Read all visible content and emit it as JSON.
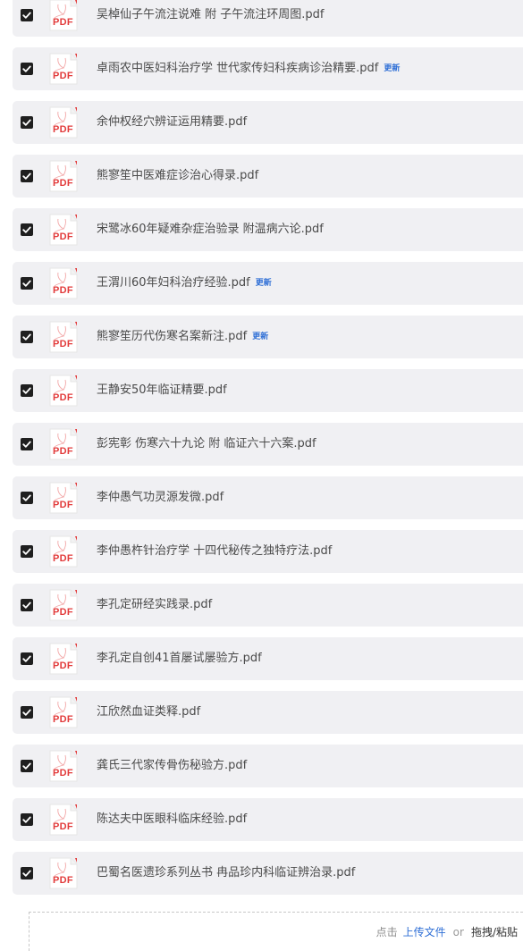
{
  "files": [
    {
      "name": "吴棹仙子午流注说难  附  子午流注环周图.pdf",
      "checked": true,
      "badge": ""
    },
    {
      "name": "卓雨农中医妇科治疗学  世代家传妇科疾病诊治精要.pdf",
      "checked": true,
      "badge": "更新"
    },
    {
      "name": "余仲权经穴辨证运用精要.pdf",
      "checked": true,
      "badge": ""
    },
    {
      "name": "熊寥笙中医难症诊治心得录.pdf",
      "checked": true,
      "badge": ""
    },
    {
      "name": "宋鹭冰60年疑难杂症治验录    附温病六论.pdf",
      "checked": true,
      "badge": ""
    },
    {
      "name": "王渭川60年妇科治疗经验.pdf",
      "checked": true,
      "badge": "更新"
    },
    {
      "name": "熊寥笙历代伤寒名案新注.pdf",
      "checked": true,
      "badge": "更新"
    },
    {
      "name": "王静安50年临证精要.pdf",
      "checked": true,
      "badge": ""
    },
    {
      "name": "彭宪彰  伤寒六十九论  附  临证六十六案.pdf",
      "checked": true,
      "badge": ""
    },
    {
      "name": "李仲愚气功灵源发微.pdf",
      "checked": true,
      "badge": ""
    },
    {
      "name": "李仲愚杵针治疗学  十四代秘传之独特疗法.pdf",
      "checked": true,
      "badge": ""
    },
    {
      "name": "李孔定研经实践录.pdf",
      "checked": true,
      "badge": ""
    },
    {
      "name": "李孔定自创41首屡试屡验方.pdf",
      "checked": true,
      "badge": ""
    },
    {
      "name": "江欣然血证类释.pdf",
      "checked": true,
      "badge": ""
    },
    {
      "name": "龚氏三代家传骨伤秘验方.pdf",
      "checked": true,
      "badge": ""
    },
    {
      "name": "陈达夫中医眼科临床经验.pdf",
      "checked": true,
      "badge": ""
    },
    {
      "name": "巴蜀名医遗珍系列丛书  冉品珍内科临证辨治录.pdf",
      "checked": true,
      "badge": ""
    }
  ],
  "pdf_icon_label": "PDF",
  "upload": {
    "prefix": "点击",
    "link": "上传文件",
    "or": "or",
    "drag": "拖拽/粘贴"
  },
  "colors": {
    "row_bg": "#f0f0f3",
    "checkbox": "#1f1f1f",
    "pdf_red": "#e23b3b",
    "badge_blue": "#2f6fd6"
  }
}
